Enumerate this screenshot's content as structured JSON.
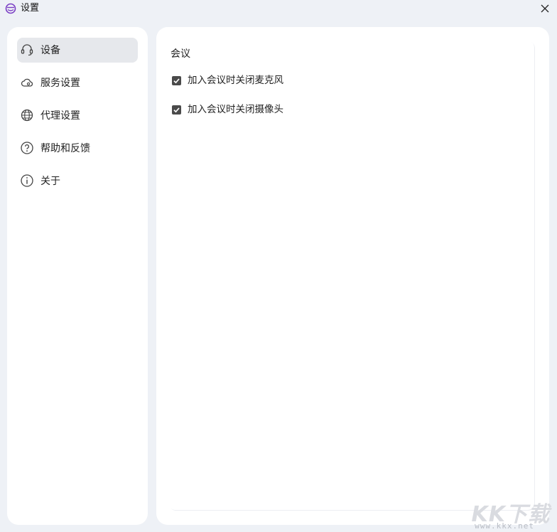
{
  "window": {
    "title": "设置",
    "close_icon": "close-icon",
    "logo_icon": "app-logo-icon",
    "accent": "#7b3fc4"
  },
  "sidebar": {
    "items": [
      {
        "label": "设备",
        "icon": "headset-icon",
        "active": true
      },
      {
        "label": "服务设置",
        "icon": "cloud-icon",
        "active": false
      },
      {
        "label": "代理设置",
        "icon": "globe-icon",
        "active": false
      },
      {
        "label": "帮助和反馈",
        "icon": "question-icon",
        "active": false
      },
      {
        "label": "关于",
        "icon": "info-icon",
        "active": false
      }
    ]
  },
  "main": {
    "section_title": "会议",
    "options": [
      {
        "label": "加入会议时关闭麦克风",
        "checked": true
      },
      {
        "label": "加入会议时关闭摄像头",
        "checked": true
      }
    ]
  },
  "watermark": {
    "text": "KK下载",
    "url": "www.kkx.net"
  }
}
